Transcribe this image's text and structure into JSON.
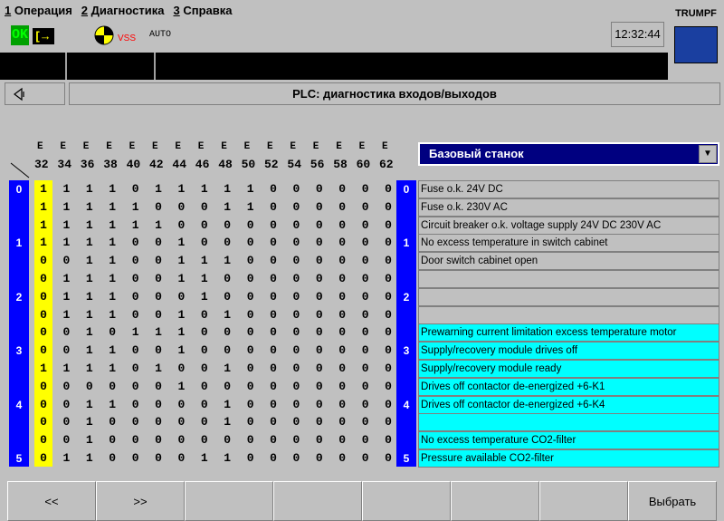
{
  "menu": [
    {
      "num": "1",
      "label": "Операция"
    },
    {
      "num": "2",
      "label": "Диагностика"
    },
    {
      "num": "3",
      "label": "Справка"
    }
  ],
  "status": {
    "ok": "OK",
    "vss": "VSS",
    "mode": "AUTO",
    "time": "12:32:44",
    "brand": "TRUMPF"
  },
  "title": "PLC: диагностика входов/выходов",
  "dropdown": {
    "selected": "Базовый станок"
  },
  "columns": [
    "32",
    "34",
    "36",
    "38",
    "40",
    "42",
    "44",
    "46",
    "48",
    "50",
    "52",
    "54",
    "56",
    "58",
    "60",
    "62"
  ],
  "column_prefix": "E",
  "row_labels": [
    "0",
    "1",
    "2",
    "3",
    "4",
    "5"
  ],
  "matrix": [
    [
      "1",
      "1",
      "1",
      "1",
      "0",
      "1",
      "1",
      "1",
      "1",
      "1",
      "0",
      "0",
      "0",
      "0",
      "0",
      "0"
    ],
    [
      "1",
      "1",
      "1",
      "1",
      "1",
      "0",
      "0",
      "0",
      "1",
      "1",
      "0",
      "0",
      "0",
      "0",
      "0",
      "0"
    ],
    [
      "1",
      "1",
      "1",
      "1",
      "1",
      "1",
      "0",
      "0",
      "0",
      "0",
      "0",
      "0",
      "0",
      "0",
      "0",
      "0"
    ],
    [
      "1",
      "1",
      "1",
      "1",
      "0",
      "0",
      "1",
      "0",
      "0",
      "0",
      "0",
      "0",
      "0",
      "0",
      "0",
      "0"
    ],
    [
      "0",
      "0",
      "1",
      "1",
      "0",
      "0",
      "1",
      "1",
      "1",
      "0",
      "0",
      "0",
      "0",
      "0",
      "0",
      "0"
    ],
    [
      "0",
      "1",
      "1",
      "1",
      "0",
      "0",
      "1",
      "1",
      "0",
      "0",
      "0",
      "0",
      "0",
      "0",
      "0",
      "0"
    ],
    [
      "0",
      "1",
      "1",
      "1",
      "0",
      "0",
      "0",
      "1",
      "0",
      "0",
      "0",
      "0",
      "0",
      "0",
      "0",
      "0"
    ],
    [
      "0",
      "1",
      "1",
      "1",
      "0",
      "0",
      "1",
      "0",
      "1",
      "0",
      "0",
      "0",
      "0",
      "0",
      "0",
      "0"
    ],
    [
      "0",
      "0",
      "1",
      "0",
      "1",
      "1",
      "1",
      "0",
      "0",
      "0",
      "0",
      "0",
      "0",
      "0",
      "0",
      "0"
    ],
    [
      "0",
      "0",
      "1",
      "1",
      "0",
      "0",
      "1",
      "0",
      "0",
      "0",
      "0",
      "0",
      "0",
      "0",
      "0",
      "0"
    ],
    [
      "1",
      "1",
      "1",
      "1",
      "0",
      "1",
      "0",
      "0",
      "1",
      "0",
      "0",
      "0",
      "0",
      "0",
      "0",
      "0"
    ],
    [
      "0",
      "0",
      "0",
      "0",
      "0",
      "0",
      "1",
      "0",
      "0",
      "0",
      "0",
      "0",
      "0",
      "0",
      "0",
      "0"
    ],
    [
      "0",
      "0",
      "1",
      "1",
      "0",
      "0",
      "0",
      "0",
      "1",
      "0",
      "0",
      "0",
      "0",
      "0",
      "0",
      "0"
    ],
    [
      "0",
      "0",
      "1",
      "0",
      "0",
      "0",
      "0",
      "0",
      "1",
      "0",
      "0",
      "0",
      "0",
      "0",
      "0",
      "0"
    ],
    [
      "0",
      "0",
      "1",
      "0",
      "0",
      "0",
      "0",
      "0",
      "0",
      "0",
      "0",
      "0",
      "0",
      "0",
      "0",
      "0"
    ],
    [
      "0",
      "1",
      "1",
      "0",
      "0",
      "0",
      "0",
      "1",
      "1",
      "0",
      "0",
      "0",
      "0",
      "0",
      "0",
      "0"
    ]
  ],
  "descriptions": [
    {
      "text": "Fuse o.k. 24V DC",
      "color": "#c0c0c0"
    },
    {
      "text": "Fuse o.k. 230V AC",
      "color": "#c0c0c0"
    },
    {
      "text": "Circuit breaker o.k.  voltage supply 24V DC 230V AC",
      "color": "#c0c0c0"
    },
    {
      "text": "No excess temperature in switch cabinet",
      "color": "#c0c0c0"
    },
    {
      "text": "Door switch cabinet open",
      "color": "#c0c0c0"
    },
    {
      "text": "",
      "color": "#c0c0c0"
    },
    {
      "text": "",
      "color": "#c0c0c0"
    },
    {
      "text": "",
      "color": "#c0c0c0"
    },
    {
      "text": "Prewarning current limitation excess temperature motor",
      "color": "#00ffff"
    },
    {
      "text": "Supply/recovery module drives off",
      "color": "#00ffff"
    },
    {
      "text": "Supply/recovery module ready",
      "color": "#00ffff"
    },
    {
      "text": "Drives off contactor de-energized +6-K1",
      "color": "#00ffff"
    },
    {
      "text": "Drives off contactor de-energized +6-K4",
      "color": "#00ffff"
    },
    {
      "text": "",
      "color": "#00ffff"
    },
    {
      "text": "No excess temperature CO2-filter",
      "color": "#00ffff"
    },
    {
      "text": "Pressure available CO2-filter",
      "color": "#00ffff"
    }
  ],
  "fkeys": [
    "<<",
    ">>",
    "",
    "",
    "",
    "",
    "",
    "Выбрать"
  ],
  "colors": {
    "row_strip": "#0000ff",
    "highlight_col": "#ffff00",
    "cyan": "#00ffff",
    "logo": "#1a3fa0"
  },
  "icons": {
    "back": "speaker-back-icon",
    "ball": "yellow-black-ball-icon",
    "gate": "gate-icon"
  }
}
